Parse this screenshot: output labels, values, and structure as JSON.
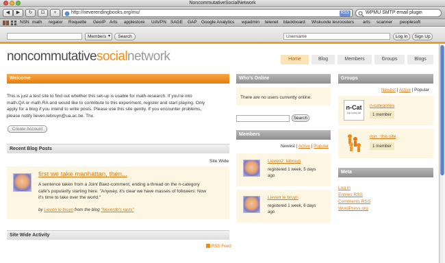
{
  "browser": {
    "window_title": "NoncommutativeSocialNetwork",
    "url": "http://neverendingbooks.org/mu/",
    "rss_badge": "RSS",
    "search_text": "WPMU SMTP email plugin",
    "buttons": {
      "back": "◀",
      "forward": "▶",
      "reload": "↻",
      "snapshot": "⊡",
      "add": "+"
    },
    "bookmarks": [
      "NSN",
      "math",
      "regator",
      "Roquette",
      "GeoIP",
      "Arts",
      "applestore",
      "UAVPN",
      "SAGE",
      "GAP",
      "Google Analytics",
      "wpadmin",
      "telenet",
      "blackboard",
      "Wiskunde lesroosters",
      "arts",
      "scanner",
      "peoplesoft"
    ]
  },
  "topbar": {
    "members_select": "Members",
    "search_button": "Search",
    "username_placeholder": "Username",
    "login_button": "Log In",
    "signup_button": "Sign Up"
  },
  "logo": {
    "part1": "noncommutative",
    "part2": "social",
    "part3": "network"
  },
  "nav": [
    "Home",
    "Blog",
    "Members",
    "Groups",
    "Blogs"
  ],
  "welcome": {
    "heading": "Welcome",
    "line1": "This is just a test site to find out whether this set-up is usable for math-research. If you're into",
    "line2": "math.QA or math.RA and would like to contribute to this experiment, register and start playing. Only",
    "line3": "apply for a blog if you intend to write posts. Please use this site gently. If you encounter problems,",
    "line4": "please notify lieven.lebruyn@ua.ac.be. Thx.",
    "create_account": "Create Account"
  },
  "recent_posts": {
    "heading": "Recent Blog Posts",
    "site_wide": "Site Wide",
    "post_title": "first we take manhattan, then...",
    "excerpt1": "A sentence taken from a Joint Baez-comment, ending a thread on the n-category",
    "excerpt2": "cafe's popularity starting here. \"Anyway, it's clear we have masses of followers. Now",
    "excerpt3": "it's time to take over the world.\"",
    "by_prefix": "by",
    "author": "Lieven le bruyn",
    "from_blog": "from the blog",
    "blog_name": "\"Neverdb's rants\""
  },
  "activity": {
    "heading": "Site Wide Activity",
    "rss": "RSS Feed"
  },
  "whos_online": {
    "heading": "Who's Online",
    "message": "There are no users currently online.",
    "search_button": "Search"
  },
  "members": {
    "heading": "Members",
    "filters": [
      "Newest",
      "Active",
      "Popular"
    ],
    "list": [
      {
        "name": "Lieven2_lebruyn",
        "registered": "registered 1 week, 5 days",
        "ago": "ago"
      },
      {
        "name": "Lieven le bruyn",
        "registered": "registered 1 week, 6 days",
        "ago": "ago"
      }
    ]
  },
  "groups": {
    "heading": "Groups",
    "filters": [
      "Newest",
      "Active",
      "Popular"
    ],
    "list": [
      {
        "name": "n-categories",
        "thumb_text": "n-Cat",
        "thumb_sub": "cup today we",
        "members": "1 member"
      },
      {
        "name": "nsn : this site",
        "members": "1 member"
      }
    ]
  },
  "meta": {
    "heading": "Meta",
    "links": [
      "Log in",
      "Entries RSS",
      "Comments RSS",
      "WordPress.org"
    ]
  },
  "colors": {
    "accent": "#f08a18",
    "header_gray": "#8e8e8e",
    "link": "#e07a10"
  }
}
